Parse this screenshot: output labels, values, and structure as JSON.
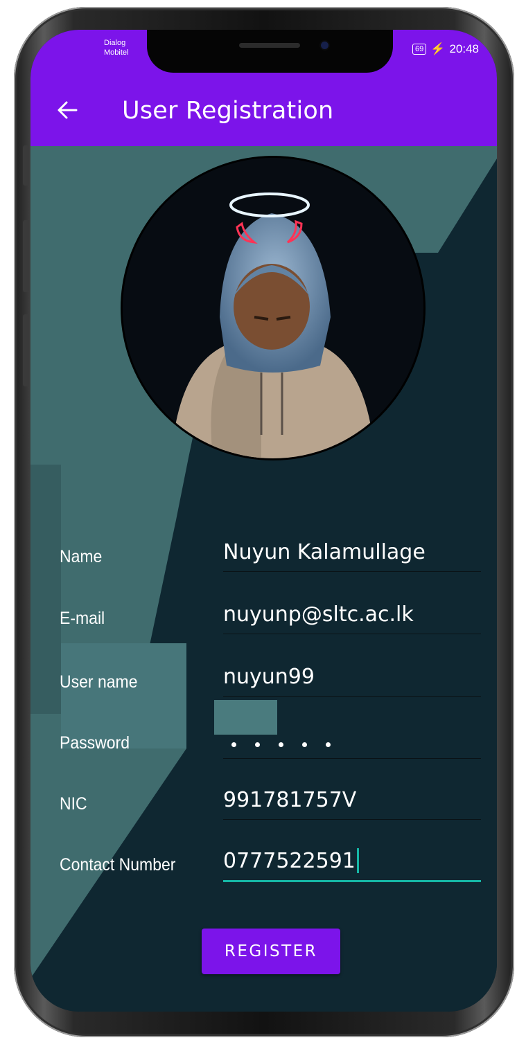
{
  "status_bar": {
    "carrier_line1": "Dialog",
    "carrier_line2": "Mobitel",
    "battery": "69",
    "time": "20:48"
  },
  "app_bar": {
    "title": "User Registration",
    "back_icon": "arrow-left-icon"
  },
  "profile": {
    "avatar": "profile-photo"
  },
  "form": {
    "fields": [
      {
        "label": "Name",
        "value": "Nuyun Kalamullage"
      },
      {
        "label": "E-mail",
        "value": "nuyunp@sltc.ac.lk"
      },
      {
        "label": "User name",
        "value": "nuyun99"
      },
      {
        "label": "Password",
        "value": "",
        "masked_length": 5
      },
      {
        "label": "NIC",
        "value": "991781757V"
      },
      {
        "label": "Contact Number",
        "value": "0777522591",
        "focused": true
      }
    ],
    "register_label": "REGISTER"
  },
  "colors": {
    "primary": "#7c14ea",
    "accent": "#16b7a6",
    "background_dark": "#0f2731",
    "background_light": "#406c6e"
  }
}
